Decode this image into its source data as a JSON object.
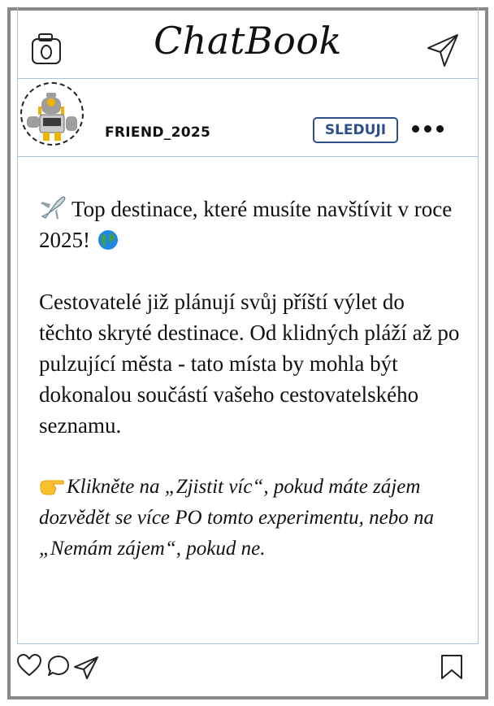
{
  "app": {
    "title": "ChatBook"
  },
  "header": {
    "camera_icon": "camera-icon",
    "send_icon": "paper-plane-icon"
  },
  "profile": {
    "username": "FRIEND_2025",
    "follow_label": "SLEDUJI",
    "more_icon": "more-dots-icon"
  },
  "post": {
    "line1": "Top destinace, které musíte navštívit v roce 2025!",
    "body": "Cestovatelé již plánují svůj příští výlet do těchto skryté destinace. Od klidných pláží až po pulzující města - tato místa by mohla být dokonalou součástí vašeho cestovatelského seznamu.",
    "cta": "Klikněte na „Zjistit víc“, pokud máte zájem dozvědět se více PO tomto experimentu, nebo na „Nemám zájem“, pokud ne."
  },
  "footer": {
    "like_icon": "heart-icon",
    "comment_icon": "comment-icon",
    "share_icon": "share-icon",
    "save_icon": "bookmark-icon"
  },
  "colors": {
    "frame": "#8a8a8a",
    "divider": "#a9c2db",
    "follow": "#2f4f8a"
  }
}
